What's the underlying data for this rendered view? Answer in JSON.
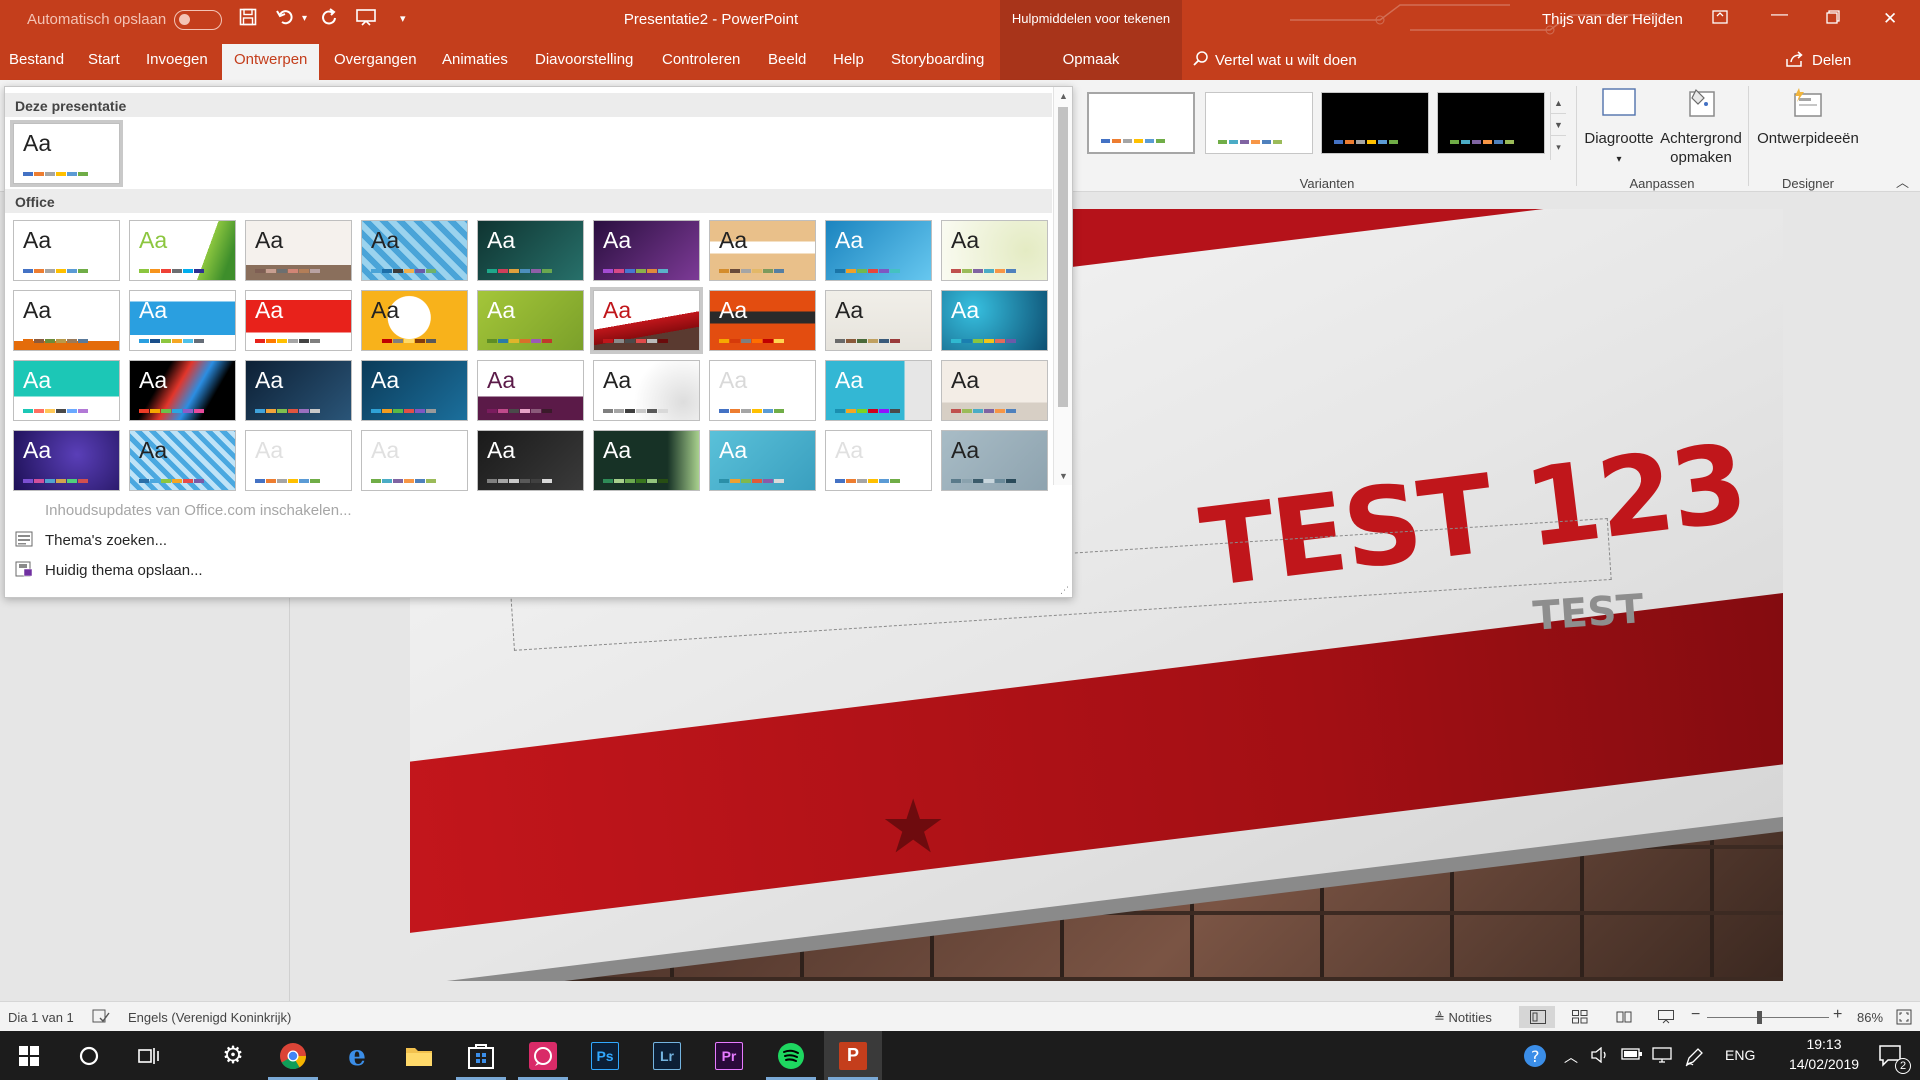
{
  "titlebar": {
    "autosave_label": "Automatisch opslaan",
    "document_title": "Presentatie2 - PowerPoint",
    "context_group": "Hulpmiddelen voor tekenen",
    "user": "Thijs van der Heijden"
  },
  "tabs": {
    "items": [
      "Bestand",
      "Start",
      "Invoegen",
      "Ontwerpen",
      "Overgangen",
      "Animaties",
      "Diavoorstelling",
      "Controleren",
      "Beeld",
      "Help",
      "Storyboarding"
    ],
    "active": "Ontwerpen",
    "context_tab": "Opmaak",
    "tell_me": "Vertel wat u wilt doen",
    "share": "Delen"
  },
  "ribbon": {
    "variants_label": "Varianten",
    "customize_label": "Aanpassen",
    "designer_label": "Designer",
    "slide_size": "Diagrootte",
    "format_background_1": "Achtergrond",
    "format_background_2": "opmaken",
    "design_ideas": "Ontwerpideeën"
  },
  "themes_panel": {
    "this_presentation": "Deze presentatie",
    "office_section": "Office",
    "sample_text": "Aa",
    "enable_updates": "Inhoudsupdates van Office.com inschakelen...",
    "browse_themes": "Thema's zoeken...",
    "save_theme": "Huidig thema opslaan..."
  },
  "slide": {
    "title": "TEST 123",
    "subtitle": "TEST"
  },
  "statusbar": {
    "slide_counter": "Dia 1 van 1",
    "language": "Engels (Verenigd Koninkrijk)",
    "notes": "Notities",
    "zoom": "86%"
  },
  "taskbar": {
    "language": "ENG",
    "time": "19:13",
    "date": "14/02/2019",
    "notification_count": "2",
    "apps": [
      {
        "name": "chrome",
        "label": ""
      },
      {
        "name": "edge",
        "label": "e"
      },
      {
        "name": "explorer",
        "label": ""
      },
      {
        "name": "store",
        "label": ""
      },
      {
        "name": "whatsapp",
        "label": ""
      },
      {
        "name": "photoshop",
        "label": "Ps"
      },
      {
        "name": "lightroom",
        "label": "Lr"
      },
      {
        "name": "premiere",
        "label": "Pr"
      },
      {
        "name": "spotify",
        "label": ""
      },
      {
        "name": "powerpoint",
        "label": "P"
      }
    ]
  },
  "colors": {
    "ppt_accent": "#c43e1c",
    "slide_red": "#c0161b"
  }
}
